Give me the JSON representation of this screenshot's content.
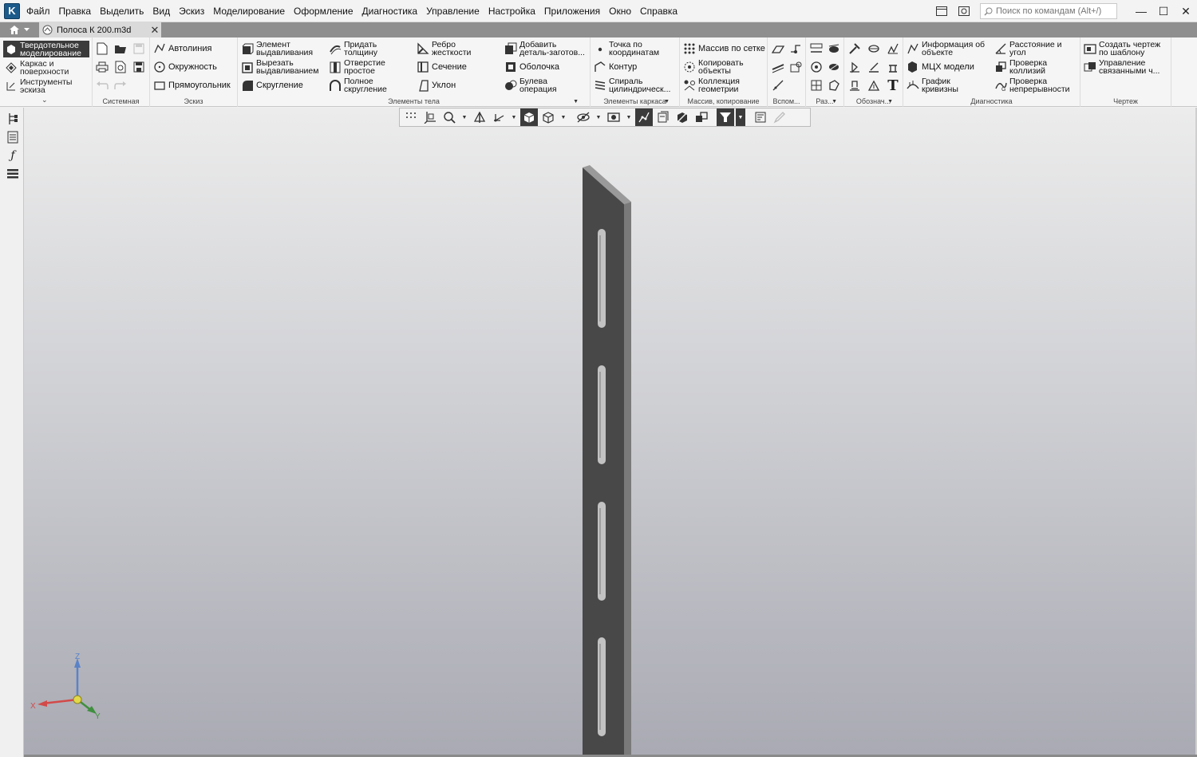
{
  "app": {
    "logo_letter": "K",
    "accent": "#1c5a8a"
  },
  "menu": [
    "Файл",
    "Правка",
    "Выделить",
    "Вид",
    "Эскиз",
    "Моделирование",
    "Оформление",
    "Диагностика",
    "Управление",
    "Настройка",
    "Приложения",
    "Окно",
    "Справка"
  ],
  "search": {
    "placeholder": "Поиск по командам (Alt+/)"
  },
  "window_controls": {
    "minimize": "—",
    "maximize": "☐",
    "close": "✕"
  },
  "tabs": {
    "document": "Полоса К 200.m3d",
    "close": "✕"
  },
  "modes": [
    {
      "label": "Твердотельное\nмоделирование",
      "active": true
    },
    {
      "label": "Каркас и\nповерхности",
      "active": false
    },
    {
      "label": "Инструменты\nэскиза",
      "active": false
    }
  ],
  "ribbon": {
    "groups": {
      "system": "Системная",
      "sketch": "Эскиз",
      "body": "Элементы тела",
      "frame": "Элементы каркаса",
      "array": "Массив, копирование",
      "aux": "Вспом...",
      "dims": "Раз...",
      "notation": "Обознач...",
      "diag": "Диагностика",
      "drawing": "Чертеж"
    },
    "sketch": [
      "Автолиния",
      "Окружность",
      "Прямоугольник"
    ],
    "body_col1": [
      "Элемент\nвыдавливания",
      "Вырезать\nвыдавливанием",
      "Скругление"
    ],
    "body_col2": [
      "Придать\nтолщину",
      "Отверстие\nпростое",
      "Полное\nскругление"
    ],
    "body_col3": [
      "Ребро\nжесткости",
      "Сечение",
      "Уклон"
    ],
    "body_col4": [
      "Добавить\nдеталь-заготов...",
      "Оболочка",
      "Булева\nоперация"
    ],
    "frame": [
      "Точка по\nкоординатам",
      "Контур",
      "Спираль\nцилиндрическ..."
    ],
    "array": [
      "Массив по сетке",
      "Копировать\nобъекты",
      "Коллекция\nгеометрии"
    ],
    "diag_col1": [
      "Информация об\nобъекте",
      "МЦХ модели",
      "График\nкривизны"
    ],
    "diag_col2": [
      "Расстояние и\nугол",
      "Проверка\nколлизий",
      "Проверка\nнепрерывности"
    ],
    "drawing": [
      "Создать чертеж\nпо шаблону",
      "Управление\nсвязанными ч..."
    ],
    "notation_text_icon": "T"
  },
  "axes": {
    "x": "X",
    "y": "Y",
    "z": "Z"
  },
  "colors": {
    "part_face": "#484848",
    "part_side": "#7a7a7a",
    "part_top": "#9a9a9a",
    "slot": "#c2c2c2"
  }
}
